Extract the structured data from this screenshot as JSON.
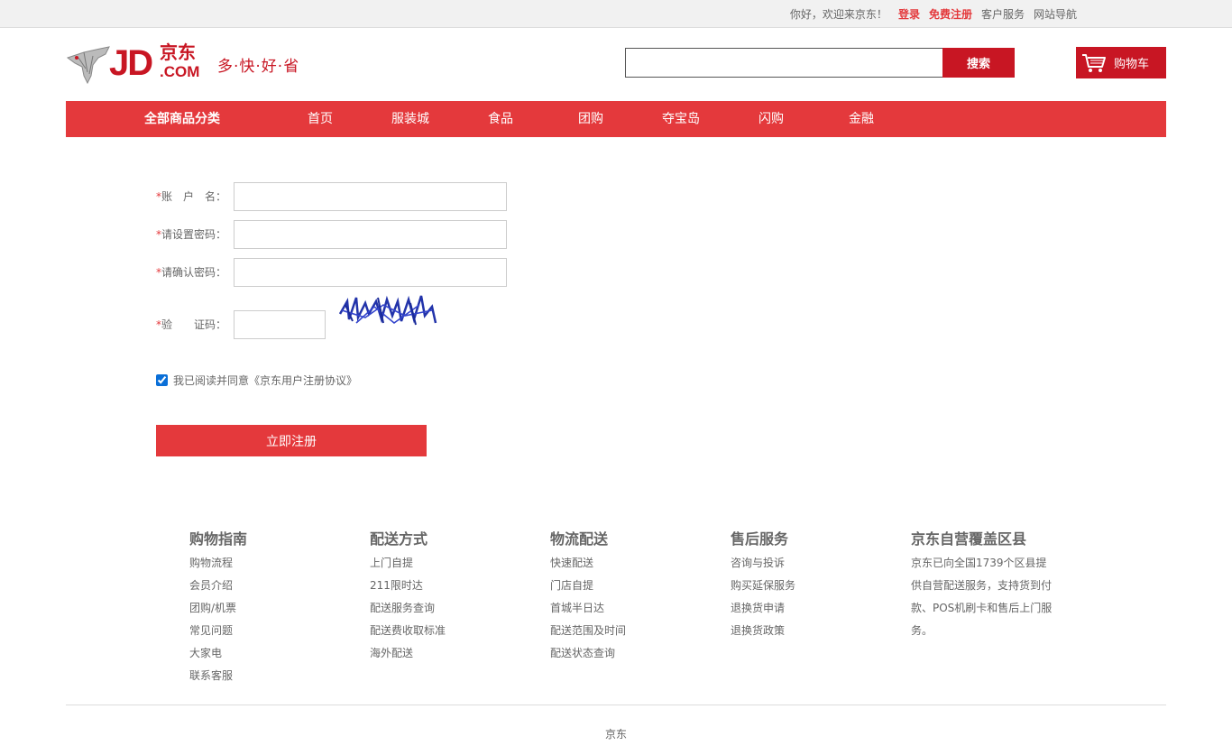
{
  "topbar": {
    "greeting": "你好，欢迎来京东！",
    "login": "登录",
    "register": "免费注册",
    "service": "客户服务",
    "sitemap": "网站导航"
  },
  "logo": {
    "jd": "JD",
    "jing": "京东",
    "com": ".COM",
    "slogan": "多·快·好·省"
  },
  "search": {
    "value": "",
    "button": "搜索"
  },
  "cart": {
    "label": "购物车"
  },
  "nav": {
    "all": "全部商品分类",
    "items": [
      "首页",
      "服装城",
      "食品",
      "团购",
      "夺宝岛",
      "闪购",
      "金融"
    ]
  },
  "form": {
    "username_label": "账　户　名：",
    "password_label": "请设置密码：",
    "confirm_label": "请确认密码：",
    "captcha_label": "验　　证码：",
    "required_mark": "*",
    "username_value": "",
    "password_value": "",
    "confirm_value": "",
    "captcha_value": "",
    "captcha_image": "captcha-image",
    "agree_text": "我已阅读并同意《京东用户注册协议》",
    "agree_checked": true,
    "submit": "立即注册"
  },
  "footer": {
    "columns": [
      {
        "title": "购物指南",
        "items": [
          "购物流程",
          "会员介绍",
          "团购/机票",
          "常见问题",
          "大家电",
          "联系客服"
        ]
      },
      {
        "title": "配送方式",
        "items": [
          "上门自提",
          "211限时达",
          "配送服务查询",
          "配送费收取标准",
          "海外配送"
        ]
      },
      {
        "title": "物流配送",
        "items": [
          "快速配送",
          "门店自提",
          "首城半日达",
          "配送范围及时间",
          "配送状态查询"
        ]
      },
      {
        "title": "售后服务",
        "items": [
          "咨询与投诉",
          "购买延保服务",
          "退换货申请",
          "退换货政策"
        ]
      },
      {
        "title": "京东自营覆盖区县",
        "text": "京东已向全国1739个区县提供自营配送服务，支持货到付款、POS机刷卡和售后上门服务。"
      }
    ],
    "copyright": "京东"
  },
  "colors": {
    "brand_red": "#e4393c",
    "dark_red": "#c81623"
  }
}
